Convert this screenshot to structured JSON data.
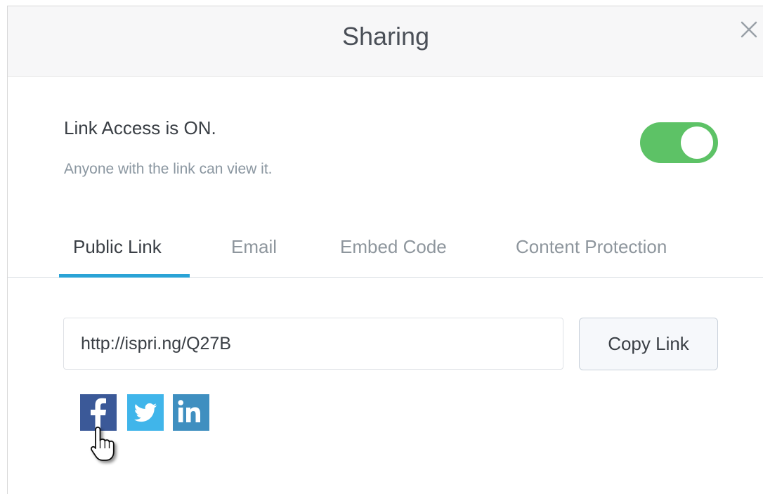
{
  "dialog": {
    "title": "Sharing",
    "close_icon": "close-icon"
  },
  "link_access": {
    "title": "Link Access is ON.",
    "subtitle": "Anyone with the link can view it.",
    "toggle_on": true,
    "toggle_color": "#5dc266"
  },
  "tabs": [
    {
      "label": "Public Link",
      "active": true
    },
    {
      "label": "Email",
      "active": false
    },
    {
      "label": "Embed Code",
      "active": false
    },
    {
      "label": "Content Protection",
      "active": false
    }
  ],
  "accent_color": "#2aa3d6",
  "public_link": {
    "url": "http://ispri.ng/Q27B",
    "copy_label": "Copy Link"
  },
  "social": [
    {
      "name": "facebook-icon",
      "color": "#3b5998"
    },
    {
      "name": "twitter-icon",
      "color": "#40b5ea"
    },
    {
      "name": "linkedin-icon",
      "color": "#3f8fc0"
    }
  ]
}
